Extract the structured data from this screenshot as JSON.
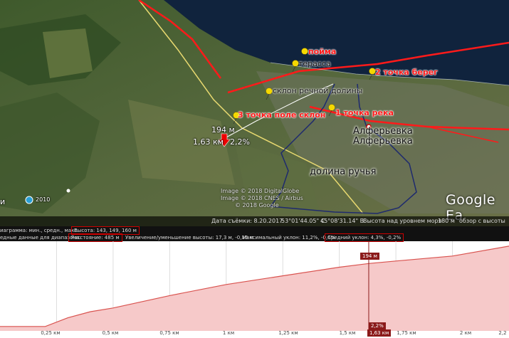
{
  "map": {
    "placemarks": [
      {
        "label": "пойма"
      },
      {
        "label": "терасса"
      },
      {
        "label": "2 точка берег"
      },
      {
        "label": "склон речной долины"
      },
      {
        "label": "1 точка река"
      },
      {
        "label": "3 точка поле склон"
      }
    ],
    "village_labels": [
      "Алферьевка",
      "Алферьевка"
    ],
    "valley_label": "долина ручья",
    "cursor_elevation": "194 м",
    "cursor_distance": "1,63 км",
    "cursor_slope": "2,2%",
    "credits": [
      "Image © 2018 DigitalGlobe",
      "Image © 2018 CNES / Airbus",
      "© 2018 Google"
    ],
    "year_badge": "2010",
    "logo": "Google Ea",
    "left_edge_label": "и",
    "status": {
      "date": "Дата съёмки: 8.20.2017",
      "lat": "53°01'44.05\" С",
      "lon": "45°08'31.14\" В",
      "elev": "Высота над уровнем моря",
      "elev_val": "180 м",
      "eye": "обзор с высоты"
    },
    "colors": {
      "water": "#10233d",
      "track_red": "#ff1a1a",
      "track_yellow": "#e8d970",
      "valley": "#1e2a6e"
    }
  },
  "profile": {
    "header_row1": {
      "label": "иаграмма: мин., средн., макс.",
      "height_box": "Высота: 143, 149, 160 м"
    },
    "header_row2": {
      "label": "едные данные для диапазона:",
      "distance_box": "Расстояние: 485 м",
      "gain": "Увеличение/уменьшение высоты: 17,3 м, -0,16 м",
      "maxslope": "Максимальный уклон: 11,2%, -0,6%",
      "avgslope": "Средний уклон: 4,3%, -0,2%"
    },
    "cursor_top": "194 м",
    "cursor_bottom": "2,2%",
    "cursor_km": "1,63 км",
    "ticks": [
      "0,25 км",
      "0,5 км",
      "0,75 км",
      "1 км",
      "1,25 км",
      "1,5 км",
      "1,75 км",
      "2 км",
      "2,2"
    ],
    "elevation_profile": {
      "x_km": [
        0,
        0.1,
        0.2,
        0.3,
        0.4,
        0.5,
        0.75,
        1.0,
        1.25,
        1.5,
        1.63,
        1.75,
        2.0,
        2.25
      ],
      "elev_m": [
        143,
        143,
        143,
        150,
        155,
        158,
        168,
        177,
        184,
        191,
        194,
        196,
        200,
        208
      ]
    },
    "colors": {
      "fill": "#f6c9c9",
      "selected_fill": "#e49a9a",
      "line": "#d9534f",
      "grid": "#dddddd"
    }
  }
}
